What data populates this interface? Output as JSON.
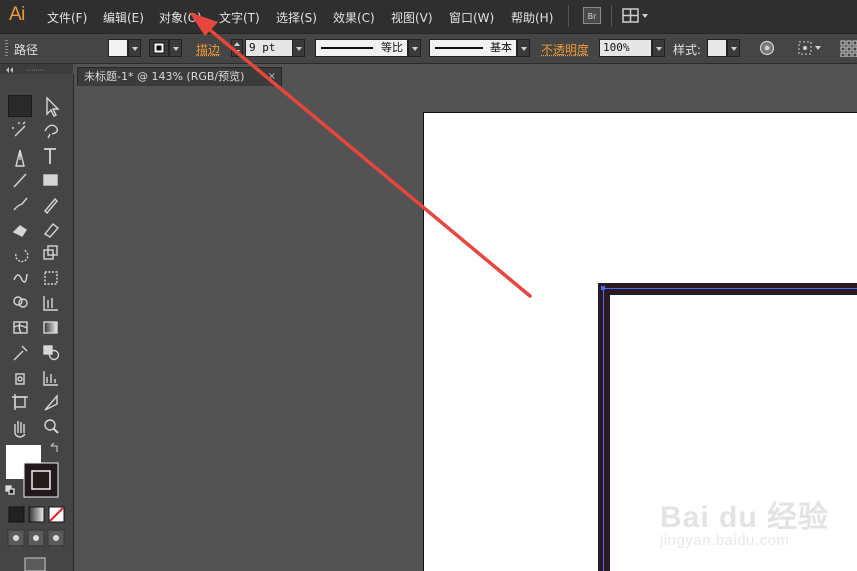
{
  "app": {
    "logo": "Ai"
  },
  "menu": {
    "items": [
      "文件(F)",
      "编辑(E)",
      "对象(O)",
      "文字(T)",
      "选择(S)",
      "效果(C)",
      "视图(V)",
      "窗口(W)",
      "帮助(H)"
    ],
    "bridge_label": "Br"
  },
  "control": {
    "selection_type": "路径",
    "stroke_label": "描边",
    "stroke_weight": "9 pt",
    "profile_uniform": "等比",
    "profile_basic": "基本",
    "opacity_label": "不透明度",
    "opacity_value": "100%",
    "style_label": "样式"
  },
  "document": {
    "tab_title": "未标题-1* @ 143% (RGB/预览)",
    "tab_close": "×"
  },
  "watermark": {
    "logo": "Bai du 经验",
    "url": "jingyan.baidu.com"
  },
  "colors": {
    "accent_orange": "#ee9a36",
    "annotation_arrow": "#e8453c",
    "path_selection": "#4a6cff"
  },
  "annotation": {
    "points_to": "对象(O)"
  }
}
